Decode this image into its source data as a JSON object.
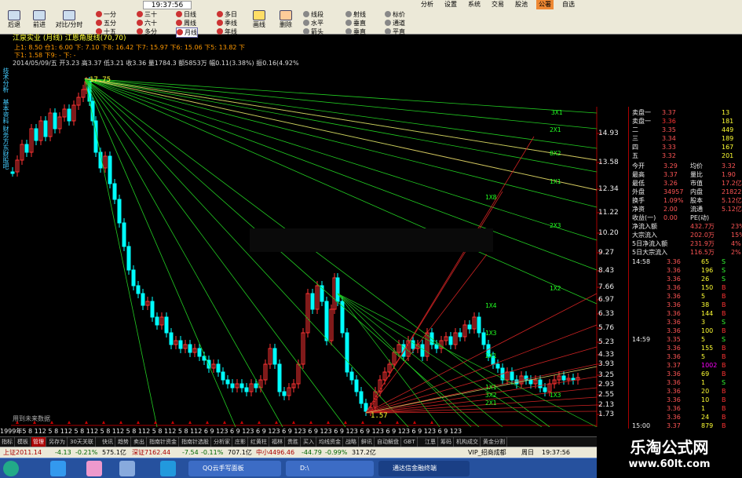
{
  "window": {
    "clock": "19:37:56"
  },
  "toolbar": {
    "buttons": [
      "后退",
      "前进",
      "对比/分时"
    ],
    "periods": [
      "一分",
      "五分",
      "十五",
      "三十",
      "六十",
      "多分",
      "日线",
      "周线",
      "月线",
      "多日",
      "季线",
      "年线"
    ]
  },
  "menu": {
    "items": [
      "分析",
      "设置",
      "系统",
      "交易",
      "股池",
      "公署",
      "自选"
    ],
    "selected": "公署"
  },
  "draw_tools": {
    "items": [
      "画线",
      "删除"
    ],
    "line_tools": [
      "线段",
      "水平",
      "箭头",
      "射线",
      "垂直",
      "垂直",
      "标价",
      "通道",
      "平直"
    ]
  },
  "chart": {
    "header": "江泉实业 (月线)  江恩角度线(70,70)",
    "indicator_line1": "上1: 8.50 仓1: 6.00 下:  7.10 下8: 16.42 下7: 15.97 下6: 15.06 下5: 13.82 下",
    "indicator_line2": "下1: 1.58 下9: -  下: -",
    "info_line": "2014/05/09/五 开3.23 高3.37 低3.21 收3.36 量1784.3 额5853万 幅0.11(3.38%) 振0.16(4.92%",
    "peak_label": "17.75",
    "low_label": "1.57",
    "future_label": "用到未来数据",
    "fan_labels_upper": [
      "3X1",
      "2X1",
      "8X2",
      "1X1",
      "2X3",
      "1X2"
    ],
    "fan_labels_lower": [
      "1X8",
      "1X4",
      "1X3",
      "2X1",
      "1X1",
      "3X2",
      "2X1",
      "1X3"
    ],
    "left_tabs": [
      "技术分析",
      "基本资料",
      "财务方",
      "东财股吧"
    ]
  },
  "price_axis": [
    "14.93",
    "13.58",
    "12.34",
    "11.22",
    "10.20",
    "9.27",
    "8.43",
    "7.66",
    "6.97",
    "6.33",
    "5.76",
    "5.23",
    "4.33",
    "3.93",
    "3.25",
    "2.93",
    "2.55",
    "2.13",
    "1.73"
  ],
  "time_axis": "1999年5 8 112 5 8 112 5 8 112 5 8 112 5 8 112 5 8 112 5 8 112 6 9 123 6 9 123 6 9 123 6 9 123 6 9 123 6 9 123 6 9 123 6 9 123 6 9 123 6 9 123",
  "order_book": {
    "sells": [
      {
        "label": "卖盘一",
        "price": "3.37",
        "vol": "13"
      },
      {
        "label": "卖盘一",
        "price": "3.36",
        "vol": "181"
      },
      {
        "label": "二",
        "price": "3.35",
        "vol": "449"
      },
      {
        "label": "三",
        "price": "3.34",
        "vol": "189"
      },
      {
        "label": "四",
        "price": "3.33",
        "vol": "167"
      },
      {
        "label": "五",
        "price": "3.32",
        "vol": "201"
      }
    ]
  },
  "quote": {
    "rows": [
      {
        "k1": "今开",
        "v1": "3.29",
        "k2": "均价",
        "v2": "3.32"
      },
      {
        "k1": "最高",
        "v1": "3.37",
        "k2": "量比",
        "v2": "1.90"
      },
      {
        "k1": "最低",
        "v1": "3.26",
        "k2": "市值",
        "v2": "17.2亿"
      },
      {
        "k1": "外盘",
        "v1": "34957",
        "k2": "内盘",
        "v2": "21822"
      },
      {
        "k1": "换手",
        "v1": "1.09%",
        "k2": "股本",
        "v2": "5.12亿"
      },
      {
        "k1": "净资",
        "v1": "2.00",
        "k2": "流通",
        "v2": "5.12亿"
      },
      {
        "k1": "收益(一)",
        "v1": "0.00",
        "k2": "PE(动)",
        "v2": ""
      }
    ],
    "flows": [
      {
        "k": "净流入额",
        "v": "432.7万",
        "p": "23%"
      },
      {
        "k": "大宗流入",
        "v": "202.0万",
        "p": "15%"
      },
      {
        "k": "5日净流入额",
        "v": "231.9万",
        "p": "4%"
      },
      {
        "k": "5日大宗流入",
        "v": "116.5万",
        "p": "2%"
      }
    ]
  },
  "trades": [
    {
      "t": "14:58",
      "p": "3.36",
      "v": "65",
      "d": "S"
    },
    {
      "t": "",
      "p": "3.36",
      "v": "196",
      "d": "S"
    },
    {
      "t": "",
      "p": "3.36",
      "v": "26",
      "d": "S"
    },
    {
      "t": "",
      "p": "3.36",
      "v": "150",
      "d": "B"
    },
    {
      "t": "",
      "p": "3.36",
      "v": "5",
      "d": "B"
    },
    {
      "t": "",
      "p": "3.36",
      "v": "38",
      "d": "B"
    },
    {
      "t": "",
      "p": "3.36",
      "v": "144",
      "d": "B"
    },
    {
      "t": "",
      "p": "3.36",
      "v": "3",
      "d": "S"
    },
    {
      "t": "",
      "p": "3.36",
      "v": "100",
      "d": "B"
    },
    {
      "t": "14:59",
      "p": "3.35",
      "v": "5",
      "d": "S"
    },
    {
      "t": "",
      "p": "3.36",
      "v": "155",
      "d": "B"
    },
    {
      "t": "",
      "p": "3.36",
      "v": "5",
      "d": "B"
    },
    {
      "t": "",
      "p": "3.37",
      "v": "1002",
      "d": "B"
    },
    {
      "t": "",
      "p": "3.36",
      "v": "69",
      "d": "B"
    },
    {
      "t": "",
      "p": "3.36",
      "v": "1",
      "d": "S"
    },
    {
      "t": "",
      "p": "3.36",
      "v": "20",
      "d": "B"
    },
    {
      "t": "",
      "p": "3.36",
      "v": "10",
      "d": "B"
    },
    {
      "t": "",
      "p": "3.36",
      "v": "1",
      "d": "B"
    },
    {
      "t": "",
      "p": "3.36",
      "v": "24",
      "d": "B"
    },
    {
      "t": "15:00",
      "p": "3.37",
      "v": "879",
      "d": "B"
    }
  ],
  "bottom_tabs": [
    "指标",
    "模板",
    "管理",
    "另存为",
    "30天关联",
    "快讯",
    "趋势",
    "卖出",
    "指南针资金",
    "指南针选股",
    "分析家",
    "庄影",
    "红黄柱",
    "福林",
    "贵胜",
    "买入",
    "均线资金",
    "战略",
    "鲜讯",
    "自动解盘",
    "GBT",
    "江恩",
    "筹码",
    "机构成交",
    "黄金分割"
  ],
  "bottom_tabs2": [
    "扩展区",
    "关联报价",
    "资金分布",
    "资金驱动",
    "主力轨迹",
    "账户",
    "持仓"
  ],
  "status": {
    "sh": "上证2011.14",
    "sh_chg": "-4.13",
    "sh_pct": "-0.21%",
    "sh_amt": "575.1亿",
    "sz": "深证7162.44",
    "sz_chg": "-7.54",
    "sz_pct": "-0.11%",
    "sz_amt": "707.1亿",
    "zx": "中小4496.46",
    "zx_chg": "-44.79",
    "zx_pct": "-0.99%",
    "zx_amt": "317.2亿",
    "vip": "VIP_招商成都",
    "day": "周日",
    "time": "19:37:56"
  },
  "watermark": {
    "line1": "乐淘公式网",
    "line2": "www.60lt.com"
  },
  "taskbar": {
    "tasks": [
      "QQ云手写面板",
      "D:\\",
      "通达信金融终端"
    ]
  },
  "colors": {
    "up": "#ff3333",
    "down": "#00ffff",
    "fan_green": "#22cc22",
    "fan_yellow": "#d8c060",
    "fan_red": "#cc2222"
  }
}
